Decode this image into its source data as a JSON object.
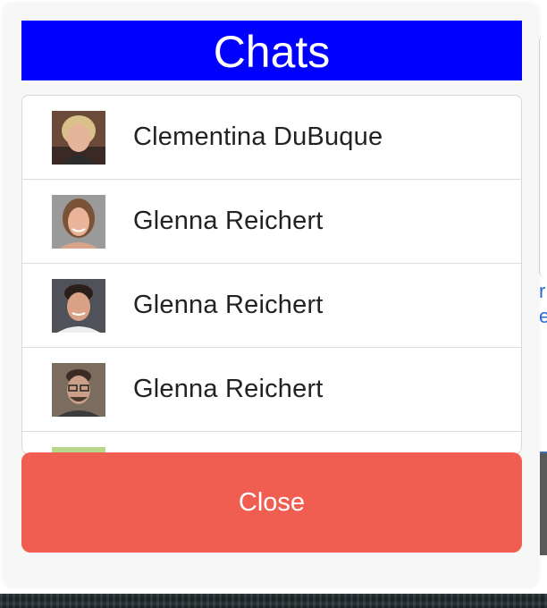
{
  "modal": {
    "title": "Chats",
    "title_bg_color": "#0000ff",
    "close_label": "Close",
    "close_color": "#ef5e51"
  },
  "chats": [
    {
      "name": "Clementina DuBuque",
      "avatar": "avatar-photo"
    },
    {
      "name": "Glenna Reichert",
      "avatar": "avatar-photo"
    },
    {
      "name": "Glenna Reichert",
      "avatar": "avatar-photo"
    },
    {
      "name": "Glenna Reichert",
      "avatar": "avatar-photo"
    },
    {
      "name": "",
      "avatar": "avatar-photo"
    }
  ]
}
